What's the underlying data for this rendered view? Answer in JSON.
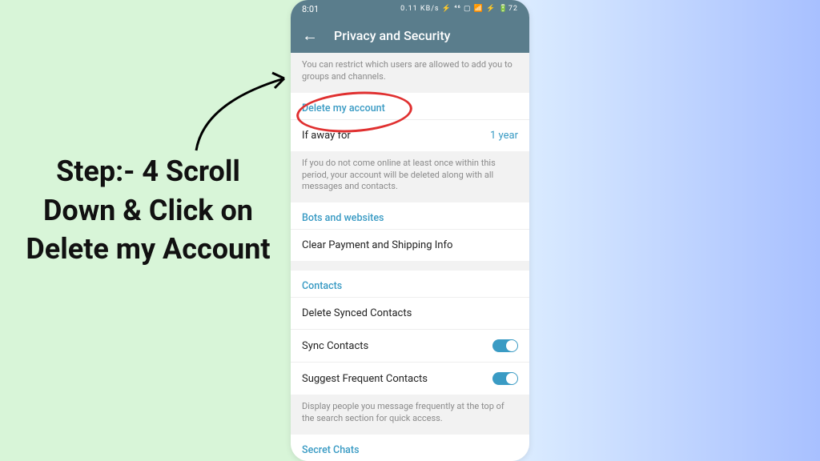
{
  "instruction": {
    "text": "Step:- 4 Scroll Down & Click on Delete my Account"
  },
  "status_bar": {
    "time": "8:01",
    "icons": "0.11 KB/s ⚡ ⁴⁶ ▢ 📶 ⚡ 🔋72"
  },
  "header": {
    "title": "Privacy and Security"
  },
  "sections": {
    "restrict_desc": "You can restrict which users are allowed to add you to groups and channels.",
    "delete_account": {
      "title": "Delete my account",
      "item_label": "If away for",
      "item_value": "1 year",
      "desc": "If you do not come online at least once within this period, your account will be deleted along with all messages and contacts."
    },
    "bots": {
      "title": "Bots and websites",
      "item1": "Clear Payment and Shipping Info"
    },
    "contacts": {
      "title": "Contacts",
      "item1": "Delete Synced Contacts",
      "item2": "Sync Contacts",
      "item3": "Suggest Frequent Contacts",
      "desc": "Display people you message frequently at the top of the search section for quick access."
    },
    "secret": {
      "title": "Secret Chats"
    }
  }
}
